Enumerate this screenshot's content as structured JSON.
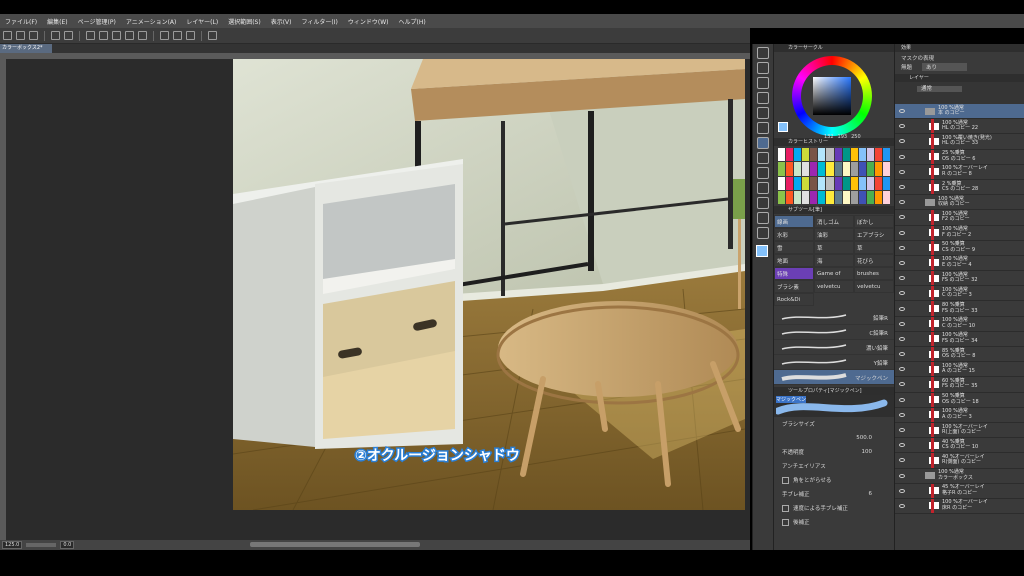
{
  "menu": [
    "ファイル(F)",
    "編集(E)",
    "ページ管理(P)",
    "アニメーション(A)",
    "レイヤー(L)",
    "選択範囲(S)",
    "表示(V)",
    "フィルター(I)",
    "ウィンドウ(W)",
    "ヘルプ(H)"
  ],
  "document_tab": "カラーボックス2*",
  "status": {
    "zoom": "125.0",
    "rotate": "0.0"
  },
  "caption": "②オクルージョンシャドウ",
  "color_panel": {
    "title": "カラーサークル",
    "rgb": [
      "132",
      "193",
      "250"
    ],
    "current_color": "#84c1fa"
  },
  "color_history_title": "カラーヒストリー",
  "subtool": {
    "title": "サブツール[筆]",
    "tabs": [
      "線画",
      "消しゴム",
      "ぼかし"
    ],
    "items": [
      "水彩",
      "油彩",
      "エアブラシ",
      "雪",
      "草",
      "草",
      "地面",
      "海",
      "花びら",
      "特殊",
      "Game of",
      "brushes",
      "ブラシ素",
      "velvetcu",
      "velvetcu",
      "Rock&Di"
    ],
    "brushes": [
      "鉛筆R",
      "C鉛筆R",
      "濃い鉛筆",
      "Y鉛筆",
      "マジックペン"
    ]
  },
  "tool_property": {
    "title": "ツールプロパティ[マジックペン]",
    "preview": "マジックペン",
    "size_label": "ブラシサイズ",
    "size_value": "500.0",
    "opacity_label": "不透明度",
    "opacity_value": "100",
    "aa_label": "アンチエイリアス",
    "corner_label": "角をとがらせる",
    "stabilize_label": "手ブレ補正",
    "stabilize_value": "6",
    "speed_label": "速度による手ブレ補正",
    "post_label": "後補正"
  },
  "effect_panel": {
    "title": "効果",
    "mask_label": "マスクの表現",
    "mask_left": "無題",
    "mask_value": "あり"
  },
  "layer_panel": {
    "title": "レイヤー",
    "blend": "通常",
    "layers": [
      {
        "line1": "100 %通常",
        "line2": "本 のコピー",
        "kind": "folder"
      },
      {
        "line1": "100 %通常",
        "line2": "HL のコピー 22",
        "kind": "layer",
        "bar": "red"
      },
      {
        "line1": "100 %覆い焼き(発光)",
        "line2": "HL のコピー 33",
        "kind": "layer",
        "bar": "red"
      },
      {
        "line1": "25 %乗算",
        "line2": "OS のコピー 6",
        "kind": "layer",
        "bar": "red"
      },
      {
        "line1": "100 %オーバーレイ",
        "line2": "R のコピー 8",
        "kind": "layer",
        "bar": "red"
      },
      {
        "line1": "2 %乗算",
        "line2": "CS のコピー 28",
        "kind": "layer",
        "bar": "red"
      },
      {
        "line1": "100 %通常",
        "line2": "収納 のコピー",
        "kind": "folder"
      },
      {
        "line1": "100 %通常",
        "line2": "F2 のコピー",
        "kind": "layer",
        "bar": "red"
      },
      {
        "line1": "100 %通常",
        "line2": "F のコピー 2",
        "kind": "layer",
        "bar": "red"
      },
      {
        "line1": "50 %乗算",
        "line2": "CS のコピー 9",
        "kind": "layer",
        "bar": "red"
      },
      {
        "line1": "100 %通常",
        "line2": "E のコピー 4",
        "kind": "layer",
        "bar": "red"
      },
      {
        "line1": "100 %通常",
        "line2": "FS のコピー 32",
        "kind": "layer",
        "bar": "red"
      },
      {
        "line1": "100 %通常",
        "line2": "C のコピー 3",
        "kind": "layer",
        "bar": "red"
      },
      {
        "line1": "80 %乗算",
        "line2": "FS のコピー 33",
        "kind": "layer",
        "bar": "red"
      },
      {
        "line1": "100 %通常",
        "line2": "C のコピー 10",
        "kind": "layer",
        "bar": "red"
      },
      {
        "line1": "100 %通常",
        "line2": "FS のコピー 34",
        "kind": "layer",
        "bar": "red"
      },
      {
        "line1": "85 %乗算",
        "line2": "OS のコピー 8",
        "kind": "layer",
        "bar": "red"
      },
      {
        "line1": "100 %通常",
        "line2": "A のコピー 15",
        "kind": "layer",
        "bar": "red"
      },
      {
        "line1": "60 %乗算",
        "line2": "FS のコピー 35",
        "kind": "layer",
        "bar": "red"
      },
      {
        "line1": "50 %乗算",
        "line2": "OS のコピー 18",
        "kind": "layer",
        "bar": "red"
      },
      {
        "line1": "100 %通常",
        "line2": "A のコピー 3",
        "kind": "layer",
        "bar": "red"
      },
      {
        "line1": "100 %オーバーレイ",
        "line2": "R(上面) のコピー",
        "kind": "layer",
        "bar": "red"
      },
      {
        "line1": "40 %乗算",
        "line2": "CS のコピー 10",
        "kind": "layer",
        "bar": "red"
      },
      {
        "line1": "40 %オーバーレイ",
        "line2": "R(側面) のコピー",
        "kind": "layer",
        "bar": "red"
      },
      {
        "line1": "100 %通常",
        "line2": "カラーボックス",
        "kind": "folder"
      },
      {
        "line1": "45 %オーバーレイ",
        "line2": "格子R のコピー",
        "kind": "layer",
        "bar": "red"
      },
      {
        "line1": "100 %オーバーレイ",
        "line2": "床R のコピー",
        "kind": "layer",
        "bar": "red"
      }
    ]
  },
  "colors": {
    "accent": "#3a73c8",
    "label_red": "#c2232c",
    "caption": "#2a7fd6"
  }
}
